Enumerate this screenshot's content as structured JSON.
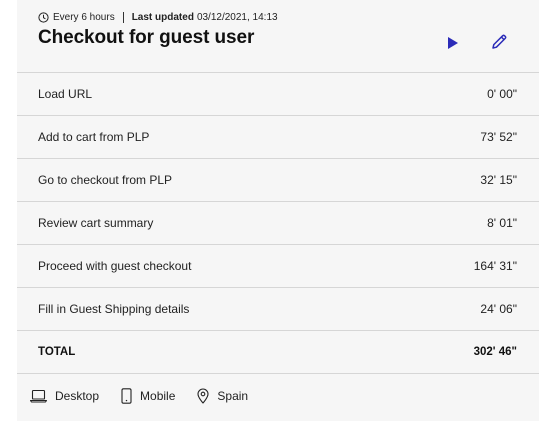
{
  "header": {
    "frequency": "Every 6 hours",
    "last_updated_label": "Last updated",
    "last_updated_value": "03/12/2021, 14:13",
    "title": "Checkout for guest user"
  },
  "steps": [
    {
      "label": "Load URL",
      "duration": "0' 00\""
    },
    {
      "label": "Add to cart from PLP",
      "duration": "73' 52\""
    },
    {
      "label": "Go to checkout from PLP",
      "duration": "32' 15\""
    },
    {
      "label": "Review cart summary",
      "duration": "8' 01\""
    },
    {
      "label": "Proceed with guest checkout",
      "duration": "164' 31\""
    },
    {
      "label": "Fill in Guest Shipping details",
      "duration": "24' 06\""
    }
  ],
  "total": {
    "label": "TOTAL",
    "duration": "302' 46\""
  },
  "footer": {
    "desktop": "Desktop",
    "mobile": "Mobile",
    "location": "Spain"
  },
  "colors": {
    "accent": "#2b2bb8",
    "card_bg": "#f6f6f6",
    "divider": "#d6d6d6"
  },
  "icons": [
    "clock-icon",
    "play-icon",
    "pencil-icon",
    "laptop-icon",
    "mobile-icon",
    "location-pin-icon"
  ]
}
